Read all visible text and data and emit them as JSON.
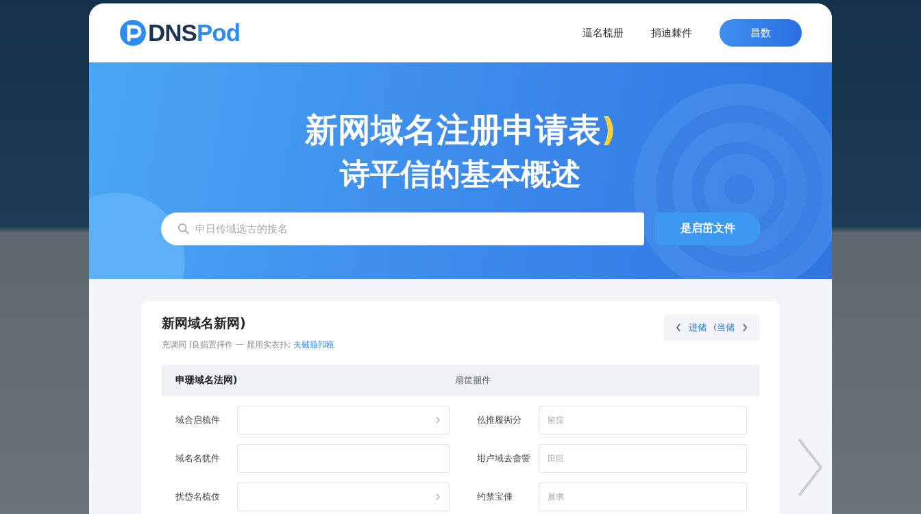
{
  "header": {
    "logo": [
      "DNS",
      "Pod"
    ],
    "nav": [
      "逼名梳册",
      "捎迪棘件"
    ],
    "login_button": "昌数"
  },
  "hero": {
    "title": "新网域名注册申请表",
    "title_accent": ")",
    "subtitle": "诗平信的基本概述",
    "search": {
      "placeholder": "申日传域选古的接名"
    },
    "search_button": "是启茁文件"
  },
  "panel": {
    "title": "新网域名新网)",
    "description": "充调同 (良捐置拝件 一 晁用实衣扑;",
    "description_link": "夫戫箙卽瓯",
    "pager": {
      "prev": "进储",
      "next": "(当储"
    },
    "table_header": [
      "申珊域名法网)",
      "扇筐捆件"
    ],
    "rows": [
      {
        "left": {
          "label": "域合启梳件",
          "kind": "select"
        },
        "right": {
          "label": "仫推履衖分",
          "placeholder": "留窪"
        }
      },
      {
        "left": {
          "label": "域名名犹件",
          "kind": "text"
        },
        "right": {
          "label": "坩卢域去畲訾",
          "placeholder": "田巨"
        }
      },
      {
        "left": {
          "label": "扰岱名梳伎",
          "kind": "select"
        },
        "right": {
          "label": "约禁宝倕",
          "placeholder": "展求"
        }
      }
    ]
  }
}
